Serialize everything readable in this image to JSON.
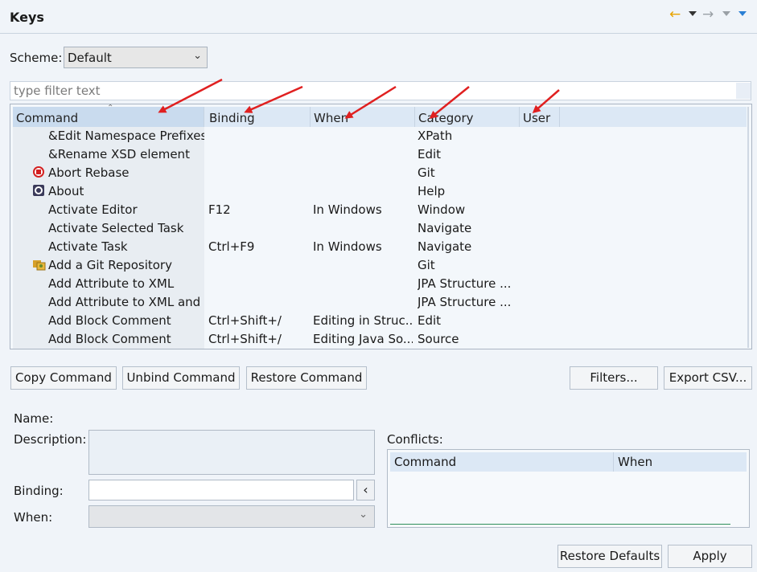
{
  "window": {
    "title": "Keys"
  },
  "scheme": {
    "label": "Scheme:",
    "value": "Default"
  },
  "filter": {
    "placeholder": "type filter text"
  },
  "table": {
    "columns": [
      "Command",
      "Binding",
      "When",
      "Category",
      "User"
    ],
    "rows": [
      {
        "command": "&Edit Namespace Prefixes",
        "binding": "",
        "when": "",
        "category": "XPath",
        "icon": ""
      },
      {
        "command": "&Rename XSD element",
        "binding": "",
        "when": "",
        "category": "Edit",
        "icon": ""
      },
      {
        "command": "Abort Rebase",
        "binding": "",
        "when": "",
        "category": "Git",
        "icon": "stop-icon"
      },
      {
        "command": "About",
        "binding": "",
        "when": "",
        "category": "Help",
        "icon": "about-icon"
      },
      {
        "command": "Activate Editor",
        "binding": "F12",
        "when": "In Windows",
        "category": "Window",
        "icon": ""
      },
      {
        "command": "Activate Selected Task",
        "binding": "",
        "when": "",
        "category": "Navigate",
        "icon": ""
      },
      {
        "command": "Activate Task",
        "binding": "Ctrl+F9",
        "when": "In Windows",
        "category": "Navigate",
        "icon": ""
      },
      {
        "command": "Add a Git Repository",
        "binding": "",
        "when": "",
        "category": "Git",
        "icon": "git-repo-icon"
      },
      {
        "command": "Add Attribute to XML",
        "binding": "",
        "when": "",
        "category": "JPA Structure ...",
        "icon": ""
      },
      {
        "command": "Add Attribute to XML and",
        "binding": "",
        "when": "",
        "category": "JPA Structure ...",
        "icon": ""
      },
      {
        "command": "Add Block Comment",
        "binding": "Ctrl+Shift+/",
        "when": "Editing in Struc...",
        "category": "Edit",
        "icon": ""
      },
      {
        "command": "Add Block Comment",
        "binding": "Ctrl+Shift+/",
        "when": "Editing Java So...",
        "category": "Source",
        "icon": ""
      }
    ]
  },
  "buttons": {
    "copy": "Copy Command",
    "unbind": "Unbind Command",
    "restore": "Restore Command",
    "filters": "Filters...",
    "export": "Export CSV...",
    "restore_defaults": "Restore Defaults",
    "apply": "Apply"
  },
  "details": {
    "name_label": "Name:",
    "description_label": "Description:",
    "binding_label": "Binding:",
    "when_label": "When:",
    "conflicts_label": "Conflicts:",
    "conflicts_columns": [
      "Command",
      "When"
    ],
    "binding_menu_glyph": "‹"
  },
  "colors": {
    "annotation_arrow": "#e02020",
    "nav_back": "#e8a300",
    "header_bg": "#dce8f5"
  }
}
